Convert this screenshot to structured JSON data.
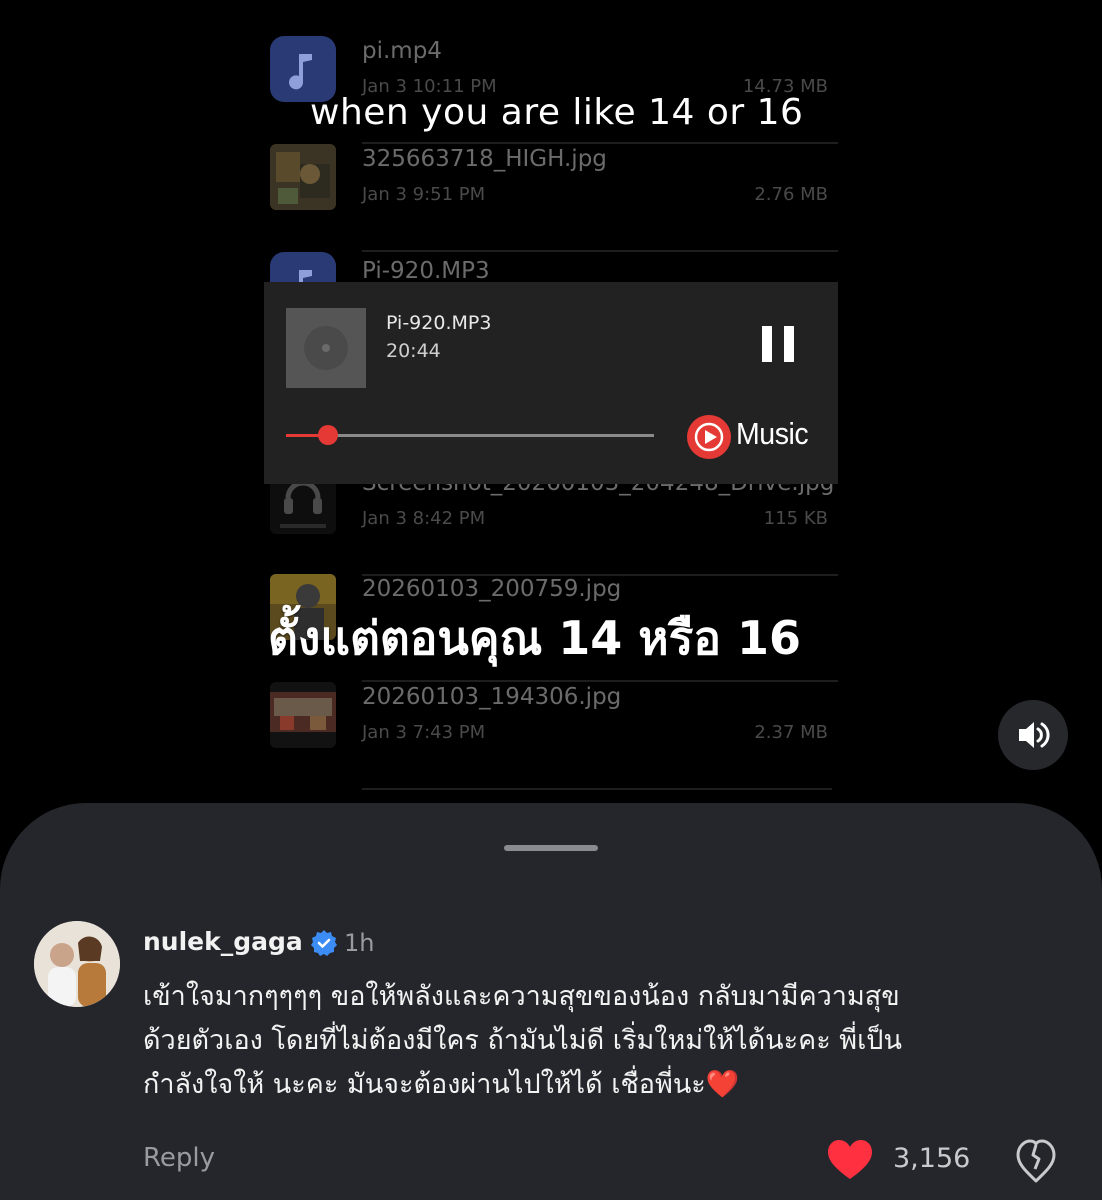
{
  "video": {
    "caption_en": "when you are like 14 or 16",
    "caption_th": "ตั้งแต่ตอนคุณ 14 หรือ 16",
    "files": [
      {
        "name": "pi.mp4",
        "date": "Jan 3 10:11 PM",
        "size": "14.73 MB",
        "thumb": "music-file-icon"
      },
      {
        "name": "325663718_HIGH.jpg",
        "date": "Jan 3 9:51 PM",
        "size": "2.76 MB",
        "thumb": "image-thumbnail"
      },
      {
        "name": "Pi-920.MP3",
        "date": "",
        "size": "",
        "thumb": "music-file-icon"
      },
      {
        "name": "Screenshot_20260103_204248_Drive.jpg",
        "date": "Jan 3 8:42 PM",
        "size": "115 KB",
        "thumb": "image-thumbnail"
      },
      {
        "name": "20260103_200759.jpg",
        "date": "",
        "size": "",
        "thumb": "image-thumbnail"
      },
      {
        "name": "20260103_194306.jpg",
        "date": "Jan 3 7:43 PM",
        "size": "2.37 MB",
        "thumb": "image-thumbnail"
      }
    ],
    "player": {
      "title": "Pi-920.MP3",
      "time": "20:44",
      "progress": 0.115,
      "brand": "Music",
      "accent": "#e53935"
    }
  },
  "comment": {
    "username": "nulek_gaga",
    "verified": true,
    "time_ago": "1h",
    "lines": [
      "เข้าใจมากๆๆๆๆ  ขอให้พลังและความสุขของน้อง กลับมามีความสุข",
      "ด้วยตัวเอง โดยที่ไม่ต้องมีใคร ถ้ามันไม่ดี  เริ่มใหม่ให้ได้นะคะ พี่เป็น",
      "กำลังใจให้  นะคะ มันจะต้องผ่านไปให้ได้  เชื่อพี่นะ❤️"
    ],
    "reply_label": "Reply",
    "like_count": "3,156",
    "like_color": "#ff3040"
  }
}
